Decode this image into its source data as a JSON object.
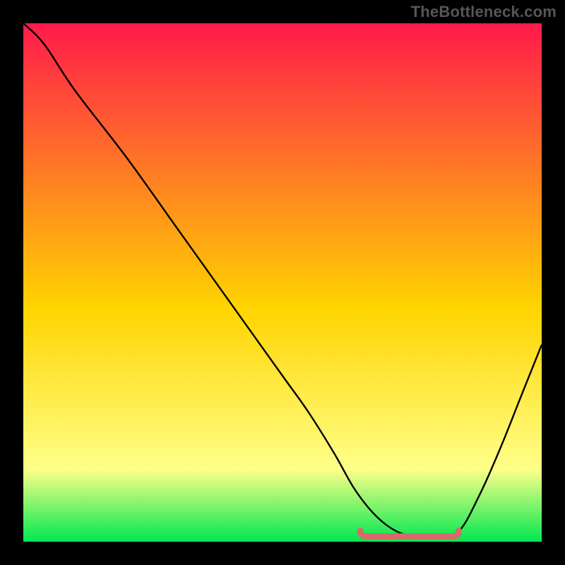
{
  "watermark": "TheBottleneck.com",
  "colors": {
    "top": "#ff1a4b",
    "mid": "#ffd400",
    "near_bottom": "#ffff88",
    "bottom": "#00e850",
    "curve": "#000000",
    "flat_marker": "#d66b6b",
    "frame": "#000000"
  },
  "chart_data": {
    "type": "line",
    "title": "",
    "xlabel": "",
    "ylabel": "",
    "xlim": [
      0,
      100
    ],
    "ylim": [
      0,
      100
    ],
    "curve": {
      "x": [
        0,
        4,
        10,
        20,
        30,
        40,
        50,
        55,
        60,
        64,
        68,
        72,
        76,
        80,
        84,
        88,
        92,
        96,
        100
      ],
      "y": [
        100,
        96,
        87,
        74,
        60,
        46,
        32,
        25,
        17,
        10,
        5,
        2,
        1,
        1,
        2,
        9,
        18,
        28,
        38
      ]
    },
    "flat_segment": {
      "x_start": 65,
      "x_end": 84,
      "y": 1
    }
  }
}
